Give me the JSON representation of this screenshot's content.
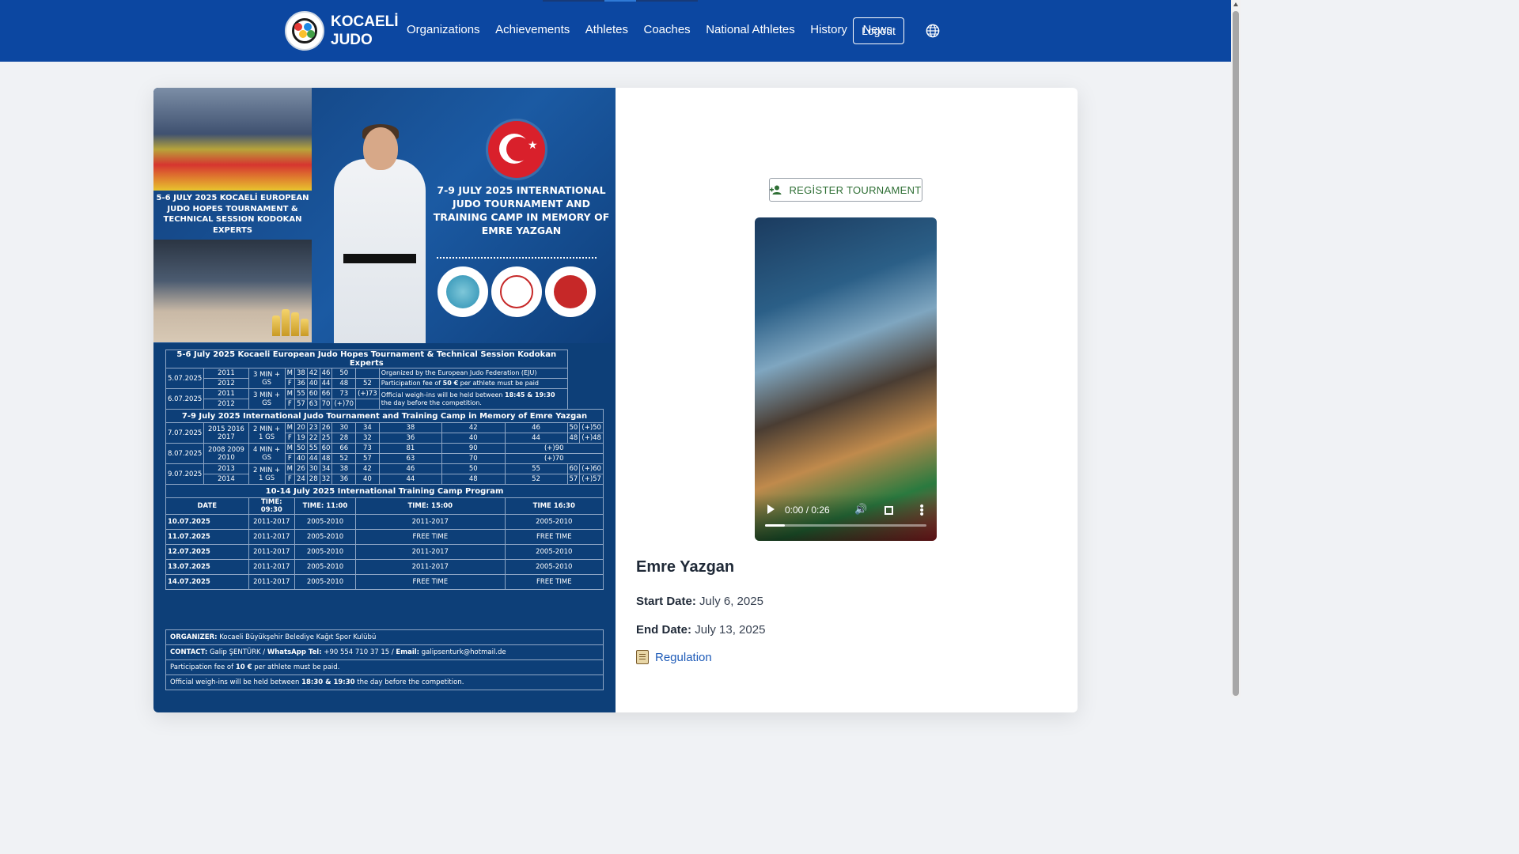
{
  "header": {
    "brand_line1": "KOCAELİ",
    "brand_line2": "JUDO",
    "nav": [
      "Organizations",
      "Achievements",
      "Athletes",
      "Coaches",
      "National Athletes",
      "History",
      "News"
    ],
    "logout_label": "Logout",
    "globe_icon": "globe-icon",
    "colors": {
      "header_bg": "#0c47a1"
    }
  },
  "poster": {
    "left_caption": "5-6 JULY 2025 KOCAELİ EUROPEAN JUDO HOPES TOURNAMENT & TECHNICAL SESSION KODOKAN EXPERTS",
    "right_caption": "7-9 JULY 2025 INTERNATIONAL JUDO TOURNAMENT AND TRAINING CAMP IN MEMORY OF EMRE YAZGAN",
    "section1_title": "5-6 July 2025 Kocaeli European Judo Hopes Tournament & Technical Session Kodokan Experts",
    "s1": {
      "d1": "5.07.2025",
      "y2011": "2011",
      "y2012": "2012",
      "dur": "3 MIN + GS",
      "m1": [
        "M",
        "38",
        "42",
        "46",
        "50",
        ""
      ],
      "f1": [
        "F",
        "36",
        "40",
        "44",
        "48",
        "52"
      ],
      "n1": "Organized by the European Judo Federation (EJU)",
      "n2a": "Participation fee of ",
      "n2b": "50 €",
      "n2c": " per athlete must be paid",
      "d2": "6.07.2025",
      "m2": [
        "M",
        "55",
        "60",
        "66",
        "73",
        "(+)73"
      ],
      "f2": [
        "F",
        "57",
        "63",
        "70",
        "(+)70",
        ""
      ],
      "n3a": "Official weigh-ins will be held between ",
      "n3b": "18:45 & 19:30",
      "n3c": " the day before the competition."
    },
    "section2_title": "7-9 July 2025 International Judo Tournament and Training Camp in Memory of Emre Yazgan",
    "s2": {
      "d1": "7.07.2025",
      "y1": "2015 2016 2017",
      "dur1": "2 MIN + 1 GS",
      "m1": [
        "M",
        "20",
        "23",
        "26",
        "30",
        "34",
        "38",
        "42",
        "46",
        "50",
        "(+)50"
      ],
      "f1": [
        "F",
        "19",
        "22",
        "25",
        "28",
        "32",
        "36",
        "40",
        "44",
        "48",
        "(+)48"
      ],
      "d2": "8.07.2025",
      "y2": "2008 2009 2010",
      "dur2": "4 MIN + GS",
      "m2": [
        "M",
        "50",
        "55",
        "60",
        "66",
        "73",
        "81",
        "90",
        "(+)90"
      ],
      "f2": [
        "F",
        "40",
        "44",
        "48",
        "52",
        "57",
        "63",
        "70",
        "(+)70"
      ],
      "d3": "9.07.2025",
      "y3a": "2013",
      "y3b": "2014",
      "dur3": "2 MIN + 1 GS",
      "m3": [
        "M",
        "26",
        "30",
        "34",
        "38",
        "42",
        "46",
        "50",
        "55",
        "60",
        "(+)60"
      ],
      "f3": [
        "F",
        "24",
        "28",
        "32",
        "36",
        "40",
        "44",
        "48",
        "52",
        "57",
        "(+)57"
      ]
    },
    "section3_title": "10-14 July 2025 International Training Camp Program",
    "s3": {
      "headers": [
        "DATE",
        "TIME: 09:30",
        "TIME: 11:00",
        "TIME: 15:00",
        "TIME 16:30"
      ],
      "rows": [
        [
          "10.07.2025",
          "2011-2017",
          "2005-2010",
          "2011-2017",
          "2005-2010"
        ],
        [
          "11.07.2025",
          "2011-2017",
          "2005-2010",
          "FREE TIME",
          "FREE TIME"
        ],
        [
          "12.07.2025",
          "2011-2017",
          "2005-2010",
          "2011-2017",
          "2005-2010"
        ],
        [
          "13.07.2025",
          "2011-2017",
          "2005-2010",
          "2011-2017",
          "2005-2010"
        ],
        [
          "14.07.2025",
          "2011-2017",
          "2005-2010",
          "FREE TIME",
          "FREE TIME"
        ]
      ]
    },
    "organizer_label": "ORGANIZER:",
    "organizer_value": " Kocaeli Büyükşehir Belediye Kağıt Spor Kulübü",
    "contact_label": "CONTACT:",
    "contact_name": " Galip ŞENTÜRK / ",
    "whatsapp_label": "WhatsApp Tel:",
    "whatsapp_value": " +90 554 710 37 15 / ",
    "email_label": "Email:",
    "email_value": " galipsenturk@hotmail.de",
    "fee_a": "Participation fee of ",
    "fee_b": "10 €",
    "fee_c": " per athlete must be paid.",
    "weigh_a": "Official weigh-ins will be held between ",
    "weigh_b": "18:30 & 19:30",
    "weigh_c": " the day before the competition."
  },
  "register_button": "REGİSTER TOURNAMENT",
  "video": {
    "time": "0:00 / 0:26",
    "progress_fraction": 0.0
  },
  "detail": {
    "name": "Emre Yazgan",
    "start_label": "Start Date:",
    "start_value": "July 6, 2025",
    "end_label": "End Date:",
    "end_value": "July 13, 2025",
    "regulation": "Regulation"
  }
}
